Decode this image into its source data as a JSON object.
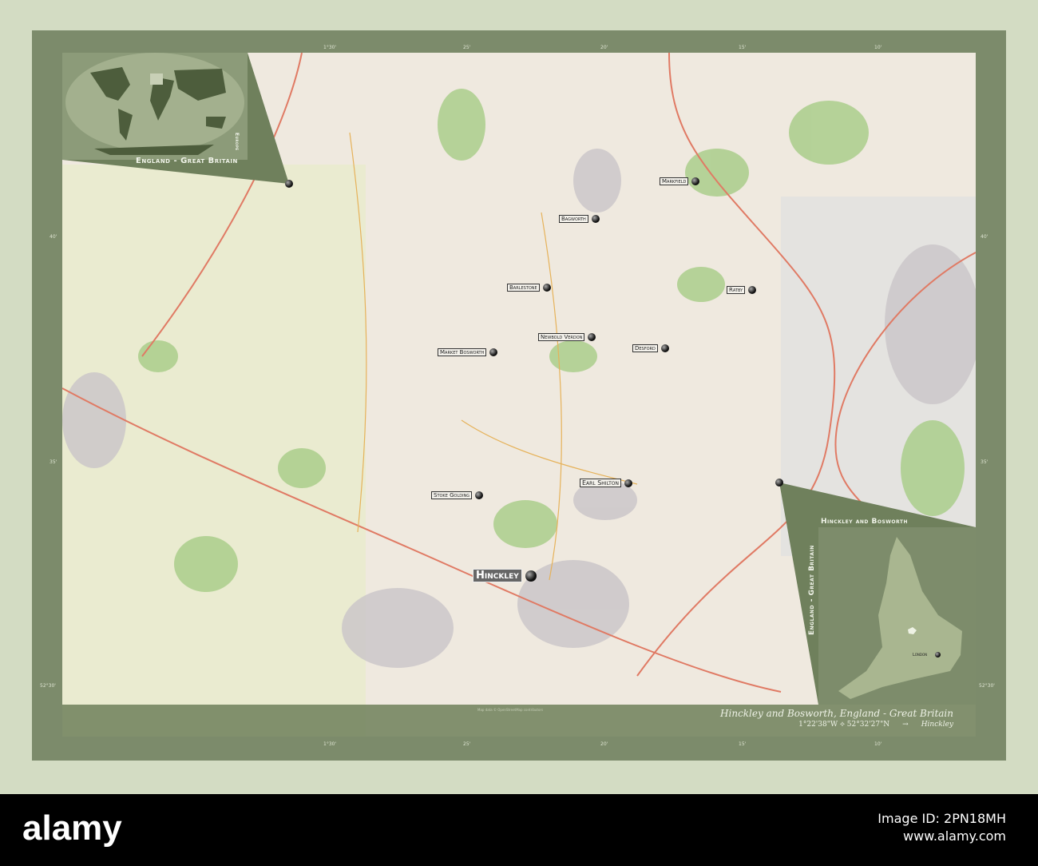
{
  "title": "Hinckley and Bosworth, England - Great Britain",
  "coords": "1°22'38\"W ⟡ 52°32'27\"N",
  "arrow": "→",
  "capital": "Hinckley",
  "credit": "Map data © OpenStreetMap contributors",
  "inset_world": {
    "title": "England - Great Britain",
    "region": "Europe"
  },
  "inset_country": {
    "title": "Hinckley and Bosworth",
    "side": "England - Great Britain",
    "city": "London"
  },
  "ticks": {
    "top": [
      "1°30'",
      "25'",
      "20'",
      "15'",
      "10'"
    ],
    "side": [
      "40'",
      "35'",
      "52°30'"
    ]
  },
  "towns": [
    {
      "name": "Markfield"
    },
    {
      "name": "Bagworth"
    },
    {
      "name": "Barlestone"
    },
    {
      "name": "Ratby"
    },
    {
      "name": "Newbold Verdon"
    },
    {
      "name": "Market Bosworth"
    },
    {
      "name": "Desford"
    },
    {
      "name": "Earl Shilton"
    },
    {
      "name": "Stoke Golding"
    },
    {
      "name": "Hinckley"
    }
  ],
  "watermark": {
    "logo": "alamy",
    "image_id": "Image ID: 2PN18MH",
    "url": "www.alamy.com"
  }
}
